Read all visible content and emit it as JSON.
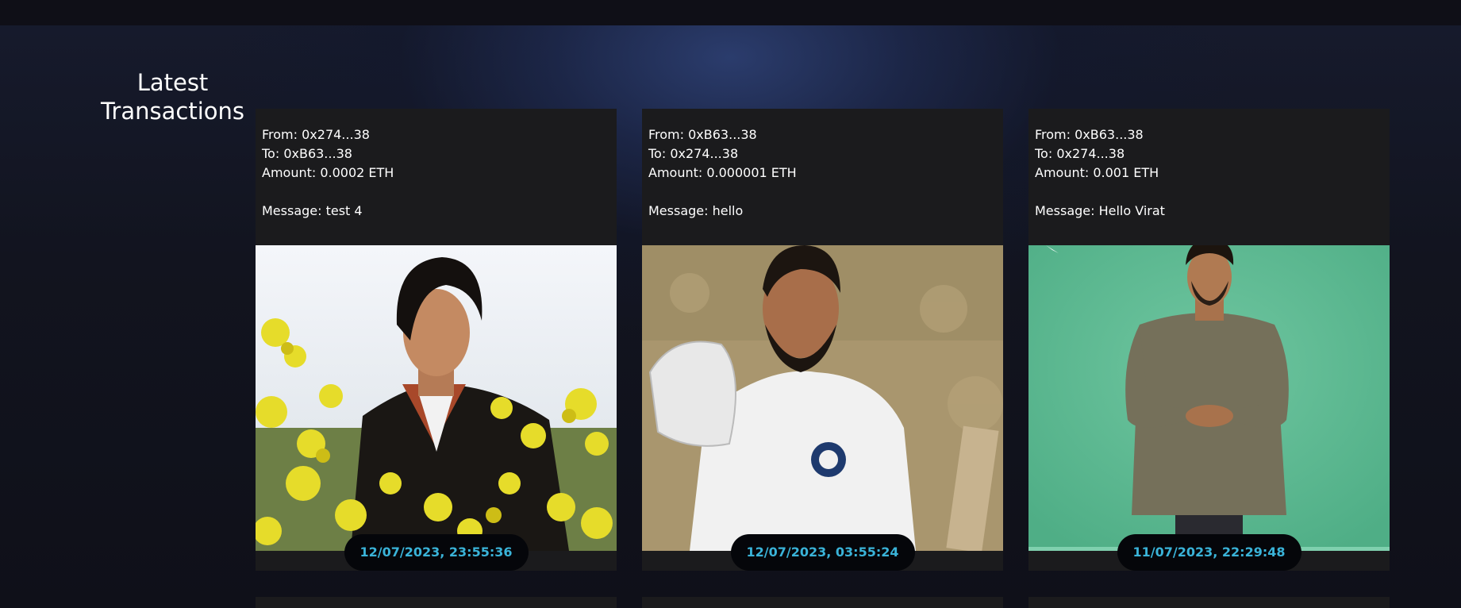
{
  "section": {
    "title_line1": "Latest",
    "title_line2": "Transactions"
  },
  "transactions": [
    {
      "from_label": "From: 0x274...38",
      "to_label": "To: 0xB63...38",
      "amount_label": "Amount: 0.0002 ETH",
      "message_label": "Message: test 4",
      "timestamp": "12/07/2023, 23:55:36",
      "image_subject": "man-in-leather-jacket-among-yellow-mustard-flowers"
    },
    {
      "from_label": "From: 0xB63...38",
      "to_label": "To: 0x274...38",
      "amount_label": "Amount: 0.000001 ETH",
      "message_label": "Message: hello",
      "timestamp": "12/07/2023, 03:55:24",
      "image_subject": "cricketer-in-white-jersey-raising-bat"
    },
    {
      "from_label": "From: 0xB63...38",
      "to_label": "To: 0x274...38",
      "amount_label": "Amount: 0.001 ETH",
      "message_label": "Message: Hello Virat",
      "timestamp": "11/07/2023, 22:29:48",
      "image_subject": "man-in-olive-tshirt-on-green-screen"
    }
  ],
  "colors": {
    "page_background": "#0e0e16",
    "card_background": "#1b1b1d",
    "timestamp_text": "#3ab3d8",
    "timestamp_pill": "#05060a",
    "text": "#ffffff"
  }
}
